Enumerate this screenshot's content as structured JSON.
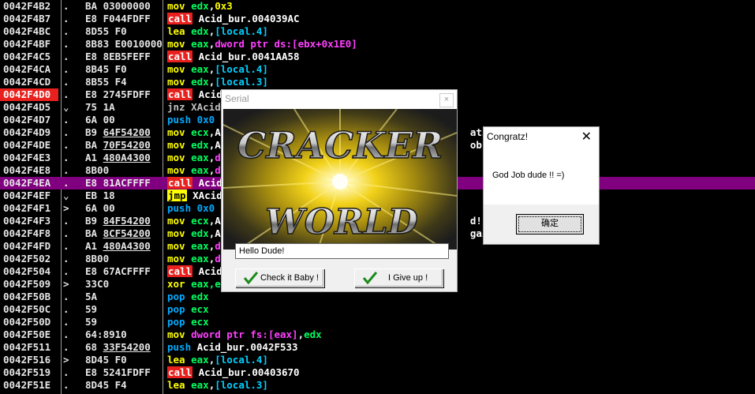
{
  "disasm": {
    "rows": [
      {
        "addr": "0042F4B2",
        "mark": ".",
        "hex": "BA 03000000",
        "parts": [
          [
            "mov",
            "m-mov"
          ],
          [
            " ",
            ""
          ],
          [
            "edx",
            "reg"
          ],
          [
            ",",
            ""
          ],
          [
            "0x3",
            "imm"
          ]
        ]
      },
      {
        "addr": "0042F4B7",
        "mark": ".",
        "hex": "E8 F044FDFF",
        "parts": [
          [
            "call",
            "m-call"
          ],
          [
            " Acid_bur.004039AC",
            "plain"
          ]
        ]
      },
      {
        "addr": "0042F4BC",
        "mark": ".",
        "hex": "8D55 F0",
        "parts": [
          [
            "lea",
            "m-lea"
          ],
          [
            " ",
            ""
          ],
          [
            "edx",
            "reg"
          ],
          [
            ",",
            ""
          ],
          [
            "[local.4]",
            "mem"
          ]
        ]
      },
      {
        "addr": "0042F4BF",
        "mark": ".",
        "hex": "8B83 E0010000",
        "parts": [
          [
            "mov",
            "m-mov"
          ],
          [
            " ",
            ""
          ],
          [
            "eax",
            "reg"
          ],
          [
            ",",
            ""
          ],
          [
            "dword ptr ds:[ebx+0x1E0]",
            "ptr"
          ]
        ]
      },
      {
        "addr": "0042F4C5",
        "mark": ".",
        "hex": "E8 8EB5FEFF",
        "parts": [
          [
            "call",
            "m-call"
          ],
          [
            " Acid_bur.0041AA58",
            "plain"
          ]
        ]
      },
      {
        "addr": "0042F4CA",
        "mark": ".",
        "hex": "8B45 F0",
        "parts": [
          [
            "mov",
            "m-mov"
          ],
          [
            " ",
            ""
          ],
          [
            "eax",
            "reg"
          ],
          [
            ",",
            ""
          ],
          [
            "[local.4]",
            "mem"
          ]
        ]
      },
      {
        "addr": "0042F4CD",
        "mark": ".",
        "hex": "8B55 F4",
        "parts": [
          [
            "mov",
            "m-mov"
          ],
          [
            " ",
            ""
          ],
          [
            "edx",
            "reg"
          ],
          [
            ",",
            ""
          ],
          [
            "[local.3]",
            "mem"
          ]
        ]
      },
      {
        "addr": "0042F4D0",
        "mark": ".",
        "hex": "E8 2745FDFF",
        "cur": true,
        "parts": [
          [
            "call",
            "m-call"
          ],
          [
            " Acid",
            "plain"
          ]
        ]
      },
      {
        "addr": "0042F4D5",
        "mark": "⌄",
        "hex": "75 1A",
        "parts": [
          [
            "jnz",
            "m-jnz"
          ],
          [
            " XAcid",
            "m-jnz"
          ]
        ]
      },
      {
        "addr": "0042F4D7",
        "mark": ".",
        "hex": "6A 00",
        "parts": [
          [
            "push",
            "m-push"
          ],
          [
            " 0x0",
            "m-push"
          ]
        ]
      },
      {
        "addr": "0042F4D9",
        "mark": ".",
        "hex": "B9 64F54200",
        "u": "64F54200",
        "parts": [
          [
            "mov",
            "m-mov"
          ],
          [
            " ",
            ""
          ],
          [
            "ecx",
            "reg"
          ],
          [
            ",A",
            "plain"
          ],
          [
            "                                          atz!",
            "plain"
          ]
        ]
      },
      {
        "addr": "0042F4DE",
        "mark": ".",
        "hex": "BA 70F54200",
        "u": "70F54200",
        "parts": [
          [
            "mov",
            "m-mov"
          ],
          [
            " ",
            ""
          ],
          [
            "edx",
            "reg"
          ],
          [
            ",A",
            "plain"
          ],
          [
            "                                          ob d",
            "plain"
          ]
        ]
      },
      {
        "addr": "0042F4E3",
        "mark": ".",
        "hex": "A1 480A4300",
        "u": "480A4300",
        "parts": [
          [
            "mov",
            "m-mov"
          ],
          [
            " ",
            ""
          ],
          [
            "eax",
            "reg"
          ],
          [
            ",",
            "plain"
          ],
          [
            "d",
            "ptr"
          ]
        ]
      },
      {
        "addr": "0042F4E8",
        "mark": ".",
        "hex": "8B00",
        "parts": [
          [
            "mov",
            "m-mov"
          ],
          [
            " ",
            ""
          ],
          [
            "eax",
            "reg"
          ],
          [
            ",",
            "plain"
          ],
          [
            "d",
            "ptr"
          ]
        ]
      },
      {
        "addr": "0042F4EA",
        "mark": ".",
        "hex": "E8 81ACFFFF",
        "hl": true,
        "parts": [
          [
            "call",
            "m-call"
          ],
          [
            " Acid",
            "plain"
          ]
        ]
      },
      {
        "addr": "0042F4EF",
        "mark": "⌄",
        "hex": "EB 18",
        "parts": [
          [
            "jmp",
            "m-jmp"
          ],
          [
            " XAcid",
            "plain"
          ]
        ]
      },
      {
        "addr": "0042F4F1",
        "mark": ">",
        "hex": "6A 00",
        "parts": [
          [
            "push",
            "m-push"
          ],
          [
            " 0x0",
            "m-push"
          ]
        ]
      },
      {
        "addr": "0042F4F3",
        "mark": ".",
        "hex": "B9 84F54200",
        "u": "84F54200",
        "parts": [
          [
            "mov",
            "m-mov"
          ],
          [
            " ",
            ""
          ],
          [
            "ecx",
            "reg"
          ],
          [
            ",A",
            "plain"
          ],
          [
            "                                          d!",
            "plain"
          ]
        ]
      },
      {
        "addr": "0042F4F8",
        "mark": ".",
        "hex": "BA 8CF54200",
        "u": "8CF54200",
        "parts": [
          [
            "mov",
            "m-mov"
          ],
          [
            " ",
            ""
          ],
          [
            "edx",
            "reg"
          ],
          [
            ",A",
            "plain"
          ],
          [
            "                                          gain",
            "plain"
          ]
        ]
      },
      {
        "addr": "0042F4FD",
        "mark": ".",
        "hex": "A1 480A4300",
        "u": "480A4300",
        "parts": [
          [
            "mov",
            "m-mov"
          ],
          [
            " ",
            ""
          ],
          [
            "eax",
            "reg"
          ],
          [
            ",",
            "plain"
          ],
          [
            "d",
            "ptr"
          ]
        ]
      },
      {
        "addr": "0042F502",
        "mark": ".",
        "hex": "8B00",
        "parts": [
          [
            "mov",
            "m-mov"
          ],
          [
            " ",
            ""
          ],
          [
            "eax",
            "reg"
          ],
          [
            ",",
            "plain"
          ],
          [
            "d",
            "ptr"
          ]
        ]
      },
      {
        "addr": "0042F504",
        "mark": ".",
        "hex": "E8 67ACFFFF",
        "parts": [
          [
            "call",
            "m-call"
          ],
          [
            " Acid",
            "plain"
          ]
        ]
      },
      {
        "addr": "0042F509",
        "mark": ">",
        "hex": "33C0",
        "parts": [
          [
            "xor",
            "m-xor"
          ],
          [
            " ",
            ""
          ],
          [
            "eax",
            "reg"
          ],
          [
            ",e",
            "reg"
          ]
        ]
      },
      {
        "addr": "0042F50B",
        "mark": ".",
        "hex": "5A",
        "parts": [
          [
            "pop",
            "m-pop"
          ],
          [
            " ",
            ""
          ],
          [
            "edx",
            "reg"
          ]
        ]
      },
      {
        "addr": "0042F50C",
        "mark": ".",
        "hex": "59",
        "parts": [
          [
            "pop",
            "m-pop"
          ],
          [
            " ",
            ""
          ],
          [
            "ecx",
            "reg"
          ]
        ]
      },
      {
        "addr": "0042F50D",
        "mark": ".",
        "hex": "59",
        "parts": [
          [
            "pop",
            "m-pop"
          ],
          [
            " ",
            ""
          ],
          [
            "ecx",
            "reg"
          ]
        ]
      },
      {
        "addr": "0042F50E",
        "mark": ".",
        "hex": "64:8910",
        "parts": [
          [
            "mov",
            "m-mov"
          ],
          [
            " ",
            ""
          ],
          [
            "dword ptr fs:[eax]",
            "ptr"
          ],
          [
            ",",
            ""
          ],
          [
            "edx",
            "reg"
          ]
        ]
      },
      {
        "addr": "0042F511",
        "mark": ".",
        "hex": "68 33F54200",
        "u": "33F54200",
        "parts": [
          [
            "push",
            "m-push"
          ],
          [
            " Acid_bur.0042F533",
            "plain"
          ]
        ]
      },
      {
        "addr": "0042F516",
        "mark": ">",
        "hex": "8D45 F0",
        "parts": [
          [
            "lea",
            "m-lea"
          ],
          [
            " ",
            ""
          ],
          [
            "eax",
            "reg"
          ],
          [
            ",",
            ""
          ],
          [
            "[local.4]",
            "mem"
          ]
        ]
      },
      {
        "addr": "0042F519",
        "mark": ".",
        "hex": "E8 5241FDFF",
        "parts": [
          [
            "call",
            "m-call"
          ],
          [
            " Acid_bur.00403670",
            "plain"
          ]
        ]
      },
      {
        "addr": "0042F51E",
        "mark": ".",
        "hex": "8D45 F4",
        "parts": [
          [
            "lea",
            "m-lea"
          ],
          [
            " ",
            ""
          ],
          [
            "eax",
            "reg"
          ],
          [
            ",",
            ""
          ],
          [
            "[local.3]",
            "mem"
          ]
        ]
      }
    ]
  },
  "serial_dialog": {
    "title": "Serial",
    "close_glyph": "×",
    "banner_line1": "CRACKER",
    "banner_line2": "WORLD",
    "name_value": "Hello Dude!",
    "check_label": "Check it Baby !",
    "giveup_label": "I Give up !"
  },
  "congratz_dialog": {
    "title": "Congratz!",
    "close_glyph": "✕",
    "message": "God Job dude !! =)",
    "ok_label": "确定"
  },
  "colors": {
    "highlight_row": "#800080",
    "current_addr": "#e8211e",
    "call_bg": "#e8211e",
    "jmp_bg": "#ffff00"
  }
}
